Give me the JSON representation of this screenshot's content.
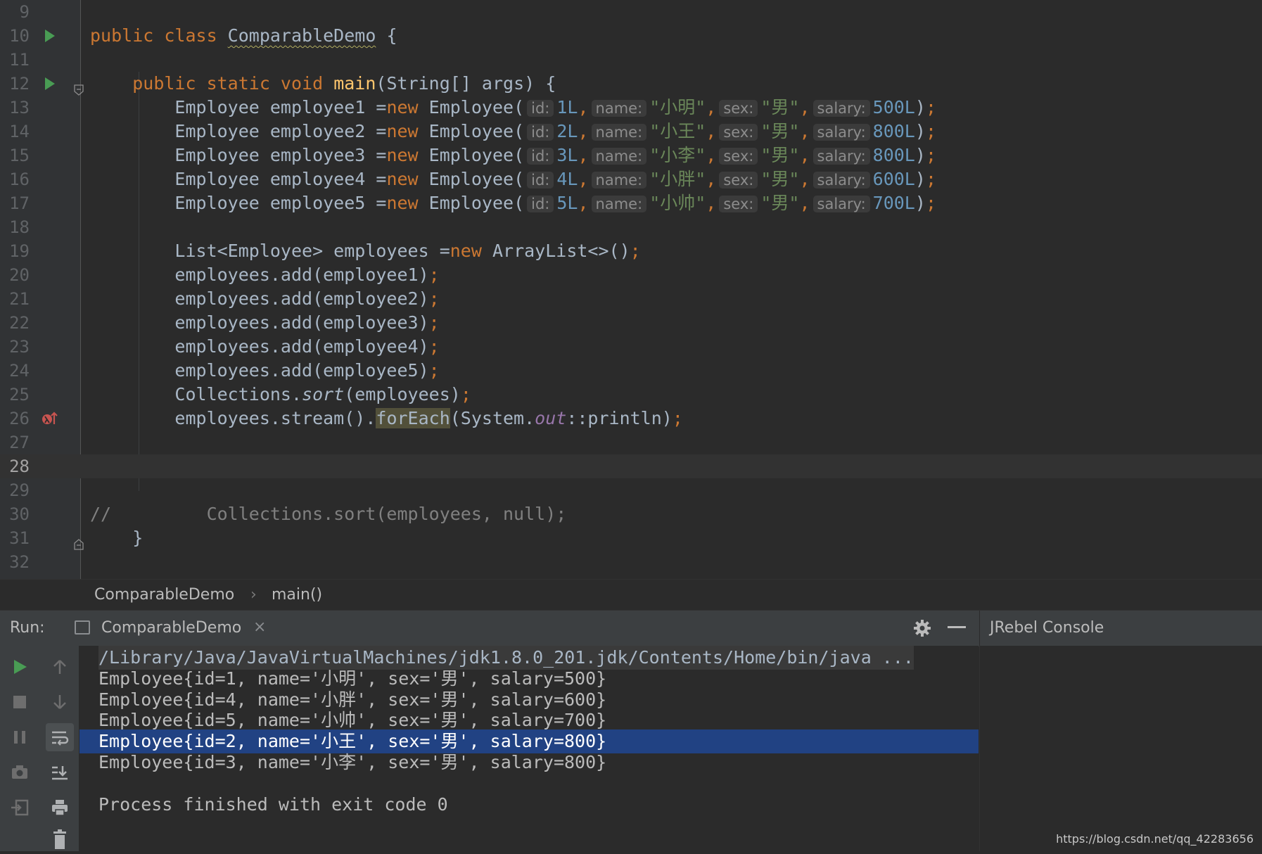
{
  "colors": {
    "editor_bg": "#2b2b2b",
    "keyword": "#cc7832",
    "method": "#ffc66d",
    "string": "#6a8759",
    "number": "#6897bb",
    "field": "#9876aa",
    "comment": "#808080",
    "selection": "#214283"
  },
  "editor": {
    "lines": [
      {
        "n": "9"
      },
      {
        "n": "10",
        "gutter_icon": "run-icon",
        "t": [
          {
            "c": "kw",
            "v": "public class "
          },
          {
            "c": "squig",
            "v": "ComparableDemo"
          },
          {
            "v": " {"
          }
        ]
      },
      {
        "n": "11"
      },
      {
        "n": "12",
        "gutter_icon": "run-icon",
        "fold": "fold-open-icon",
        "t": [
          {
            "v": "    "
          },
          {
            "c": "kw",
            "v": "public static void "
          },
          {
            "c": "fn",
            "v": "main"
          },
          {
            "v": "(String[] args) {"
          }
        ]
      },
      {
        "n": "13",
        "t": [
          {
            "v": "        Employee employee1 ="
          },
          {
            "c": "kw",
            "v": "new "
          },
          {
            "v": "Employee("
          },
          {
            "c": "hint",
            "v": "id:"
          },
          {
            "c": "num",
            "v": "1L"
          },
          {
            "c": "kw",
            "v": ","
          },
          {
            "c": "hint",
            "v": "name:"
          },
          {
            "c": "str",
            "v": "\"小明\""
          },
          {
            "c": "kw",
            "v": ","
          },
          {
            "c": "hint",
            "v": "sex:"
          },
          {
            "c": "str",
            "v": "\"男\""
          },
          {
            "c": "kw",
            "v": ","
          },
          {
            "c": "hint",
            "v": "salary:"
          },
          {
            "c": "num",
            "v": "500L"
          },
          {
            "v": ")"
          },
          {
            "c": "kw",
            "v": ";"
          }
        ]
      },
      {
        "n": "14",
        "t": [
          {
            "v": "        Employee employee2 ="
          },
          {
            "c": "kw",
            "v": "new "
          },
          {
            "v": "Employee("
          },
          {
            "c": "hint",
            "v": "id:"
          },
          {
            "c": "num",
            "v": "2L"
          },
          {
            "c": "kw",
            "v": ","
          },
          {
            "c": "hint",
            "v": "name:"
          },
          {
            "c": "str",
            "v": "\"小王\""
          },
          {
            "c": "kw",
            "v": ","
          },
          {
            "c": "hint",
            "v": "sex:"
          },
          {
            "c": "str",
            "v": "\"男\""
          },
          {
            "c": "kw",
            "v": ","
          },
          {
            "c": "hint",
            "v": "salary:"
          },
          {
            "c": "num",
            "v": "800L"
          },
          {
            "v": ")"
          },
          {
            "c": "kw",
            "v": ";"
          }
        ]
      },
      {
        "n": "15",
        "t": [
          {
            "v": "        Employee employee3 ="
          },
          {
            "c": "kw",
            "v": "new "
          },
          {
            "v": "Employee("
          },
          {
            "c": "hint",
            "v": "id:"
          },
          {
            "c": "num",
            "v": "3L"
          },
          {
            "c": "kw",
            "v": ","
          },
          {
            "c": "hint",
            "v": "name:"
          },
          {
            "c": "str",
            "v": "\"小李\""
          },
          {
            "c": "kw",
            "v": ","
          },
          {
            "c": "hint",
            "v": "sex:"
          },
          {
            "c": "str",
            "v": "\"男\""
          },
          {
            "c": "kw",
            "v": ","
          },
          {
            "c": "hint",
            "v": "salary:"
          },
          {
            "c": "num",
            "v": "800L"
          },
          {
            "v": ")"
          },
          {
            "c": "kw",
            "v": ";"
          }
        ]
      },
      {
        "n": "16",
        "t": [
          {
            "v": "        Employee employee4 ="
          },
          {
            "c": "kw",
            "v": "new "
          },
          {
            "v": "Employee("
          },
          {
            "c": "hint",
            "v": "id:"
          },
          {
            "c": "num",
            "v": "4L"
          },
          {
            "c": "kw",
            "v": ","
          },
          {
            "c": "hint",
            "v": "name:"
          },
          {
            "c": "str",
            "v": "\"小胖\""
          },
          {
            "c": "kw",
            "v": ","
          },
          {
            "c": "hint",
            "v": "sex:"
          },
          {
            "c": "str",
            "v": "\"男\""
          },
          {
            "c": "kw",
            "v": ","
          },
          {
            "c": "hint",
            "v": "salary:"
          },
          {
            "c": "num",
            "v": "600L"
          },
          {
            "v": ")"
          },
          {
            "c": "kw",
            "v": ";"
          }
        ]
      },
      {
        "n": "17",
        "t": [
          {
            "v": "        Employee employee5 ="
          },
          {
            "c": "kw",
            "v": "new "
          },
          {
            "v": "Employee("
          },
          {
            "c": "hint",
            "v": "id:"
          },
          {
            "c": "num",
            "v": "5L"
          },
          {
            "c": "kw",
            "v": ","
          },
          {
            "c": "hint",
            "v": "name:"
          },
          {
            "c": "str",
            "v": "\"小帅\""
          },
          {
            "c": "kw",
            "v": ","
          },
          {
            "c": "hint",
            "v": "sex:"
          },
          {
            "c": "str",
            "v": "\"男\""
          },
          {
            "c": "kw",
            "v": ","
          },
          {
            "c": "hint",
            "v": "salary:"
          },
          {
            "c": "num",
            "v": "700L"
          },
          {
            "v": ")"
          },
          {
            "c": "kw",
            "v": ";"
          }
        ]
      },
      {
        "n": "18"
      },
      {
        "n": "19",
        "t": [
          {
            "v": "        List<Employee> employees ="
          },
          {
            "c": "kw",
            "v": "new "
          },
          {
            "v": "ArrayList<>()"
          },
          {
            "c": "kw",
            "v": ";"
          }
        ]
      },
      {
        "n": "20",
        "t": [
          {
            "v": "        employees.add(employee1)"
          },
          {
            "c": "kw",
            "v": ";"
          }
        ]
      },
      {
        "n": "21",
        "t": [
          {
            "v": "        employees.add(employee2)"
          },
          {
            "c": "kw",
            "v": ";"
          }
        ]
      },
      {
        "n": "22",
        "t": [
          {
            "v": "        employees.add(employee3)"
          },
          {
            "c": "kw",
            "v": ";"
          }
        ]
      },
      {
        "n": "23",
        "t": [
          {
            "v": "        employees.add(employee4)"
          },
          {
            "c": "kw",
            "v": ";"
          }
        ]
      },
      {
        "n": "24",
        "t": [
          {
            "v": "        employees.add(employee5)"
          },
          {
            "c": "kw",
            "v": ";"
          }
        ]
      },
      {
        "n": "25",
        "t": [
          {
            "v": "        Collections."
          },
          {
            "c": "ital",
            "v": "sort"
          },
          {
            "v": "(employees)"
          },
          {
            "c": "kw",
            "v": ";"
          }
        ]
      },
      {
        "n": "26",
        "gutter_icon": "breakpoint-lambda-icon",
        "t": [
          {
            "v": "        employees.stream()."
          },
          {
            "c": "hl",
            "v": "forEach"
          },
          {
            "v": "(System."
          },
          {
            "c": "fld",
            "v": "out"
          },
          {
            "v": "::println)"
          },
          {
            "c": "kw",
            "v": ";"
          }
        ]
      },
      {
        "n": "27"
      },
      {
        "n": "28",
        "current": true
      },
      {
        "n": "29"
      },
      {
        "n": "30",
        "t": [
          {
            "c": "cmt",
            "v": "//         Collections.sort(employees, null);"
          }
        ]
      },
      {
        "n": "31",
        "fold": "fold-close-icon",
        "t": [
          {
            "v": "    }"
          }
        ]
      },
      {
        "n": "32"
      }
    ]
  },
  "breadcrumbs": {
    "class": "ComparableDemo",
    "method": "main()"
  },
  "run_panel": {
    "label": "Run:",
    "tab_title": "ComparableDemo",
    "close_glyph": "×",
    "jrebel_title": "JRebel Console",
    "console_lines": [
      {
        "text": "/Library/Java/JavaVirtualMachines/jdk1.8.0_201.jdk/Contents/Home/bin/java ...",
        "kind": "cmd"
      },
      {
        "text": "Employee{id=1, name='小明', sex='男', salary=500}"
      },
      {
        "text": "Employee{id=4, name='小胖', sex='男', salary=600}"
      },
      {
        "text": "Employee{id=5, name='小帅', sex='男', salary=700}"
      },
      {
        "text": "Employee{id=2, name='小王', sex='男', salary=800}",
        "kind": "sel"
      },
      {
        "text": "Employee{id=3, name='小李', sex='男', salary=800}"
      },
      {
        "text": ""
      },
      {
        "text": "Process finished with exit code 0"
      }
    ]
  },
  "watermark": "https://blog.csdn.net/qq_42283656"
}
